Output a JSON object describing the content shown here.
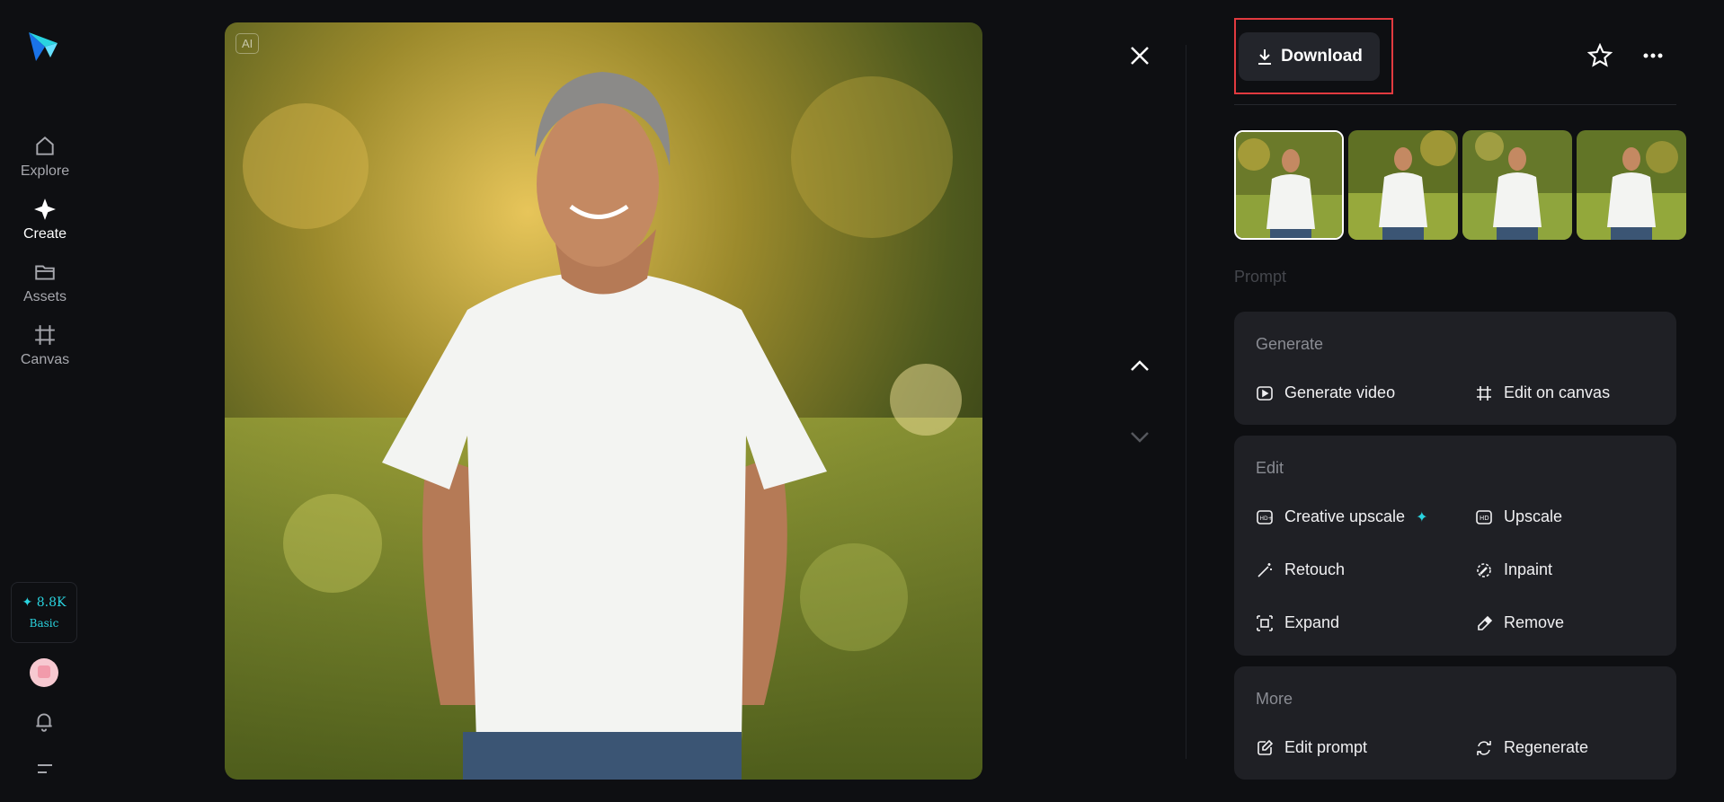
{
  "nav": {
    "items": [
      {
        "label": "Explore",
        "icon": "home-icon",
        "active": false
      },
      {
        "label": "Create",
        "icon": "sparkle-icon",
        "active": true
      },
      {
        "label": "Assets",
        "icon": "folder-icon",
        "active": false
      },
      {
        "label": "Canvas",
        "icon": "canvas-icon",
        "active": false
      }
    ]
  },
  "credits": {
    "amount": "✦ 8.8K",
    "plan": "Basic"
  },
  "image": {
    "badge": "AI"
  },
  "toolbar": {
    "download_label": "Download"
  },
  "prompt": {
    "label": "Prompt"
  },
  "sections": {
    "generate": {
      "title": "Generate",
      "actions": [
        {
          "label": "Generate video",
          "icon": "play-video-icon"
        },
        {
          "label": "Edit on canvas",
          "icon": "canvas-icon"
        }
      ]
    },
    "edit": {
      "title": "Edit",
      "actions": [
        {
          "label": "Creative upscale",
          "icon": "hd-plus-icon"
        },
        {
          "label": "Upscale",
          "icon": "hd-icon"
        },
        {
          "label": "Retouch",
          "icon": "magic-wand-icon"
        },
        {
          "label": "Inpaint",
          "icon": "inpaint-icon"
        },
        {
          "label": "Expand",
          "icon": "expand-icon"
        },
        {
          "label": "Remove",
          "icon": "eraser-icon"
        }
      ],
      "spark": "✦"
    },
    "more": {
      "title": "More",
      "actions": [
        {
          "label": "Edit prompt",
          "icon": "edit-prompt-icon"
        },
        {
          "label": "Regenerate",
          "icon": "regenerate-icon"
        }
      ]
    }
  },
  "colors": {
    "accent": "#2ad4e0",
    "highlight": "#e23a3f",
    "background": "#0e0f12",
    "card": "#1f2025"
  }
}
